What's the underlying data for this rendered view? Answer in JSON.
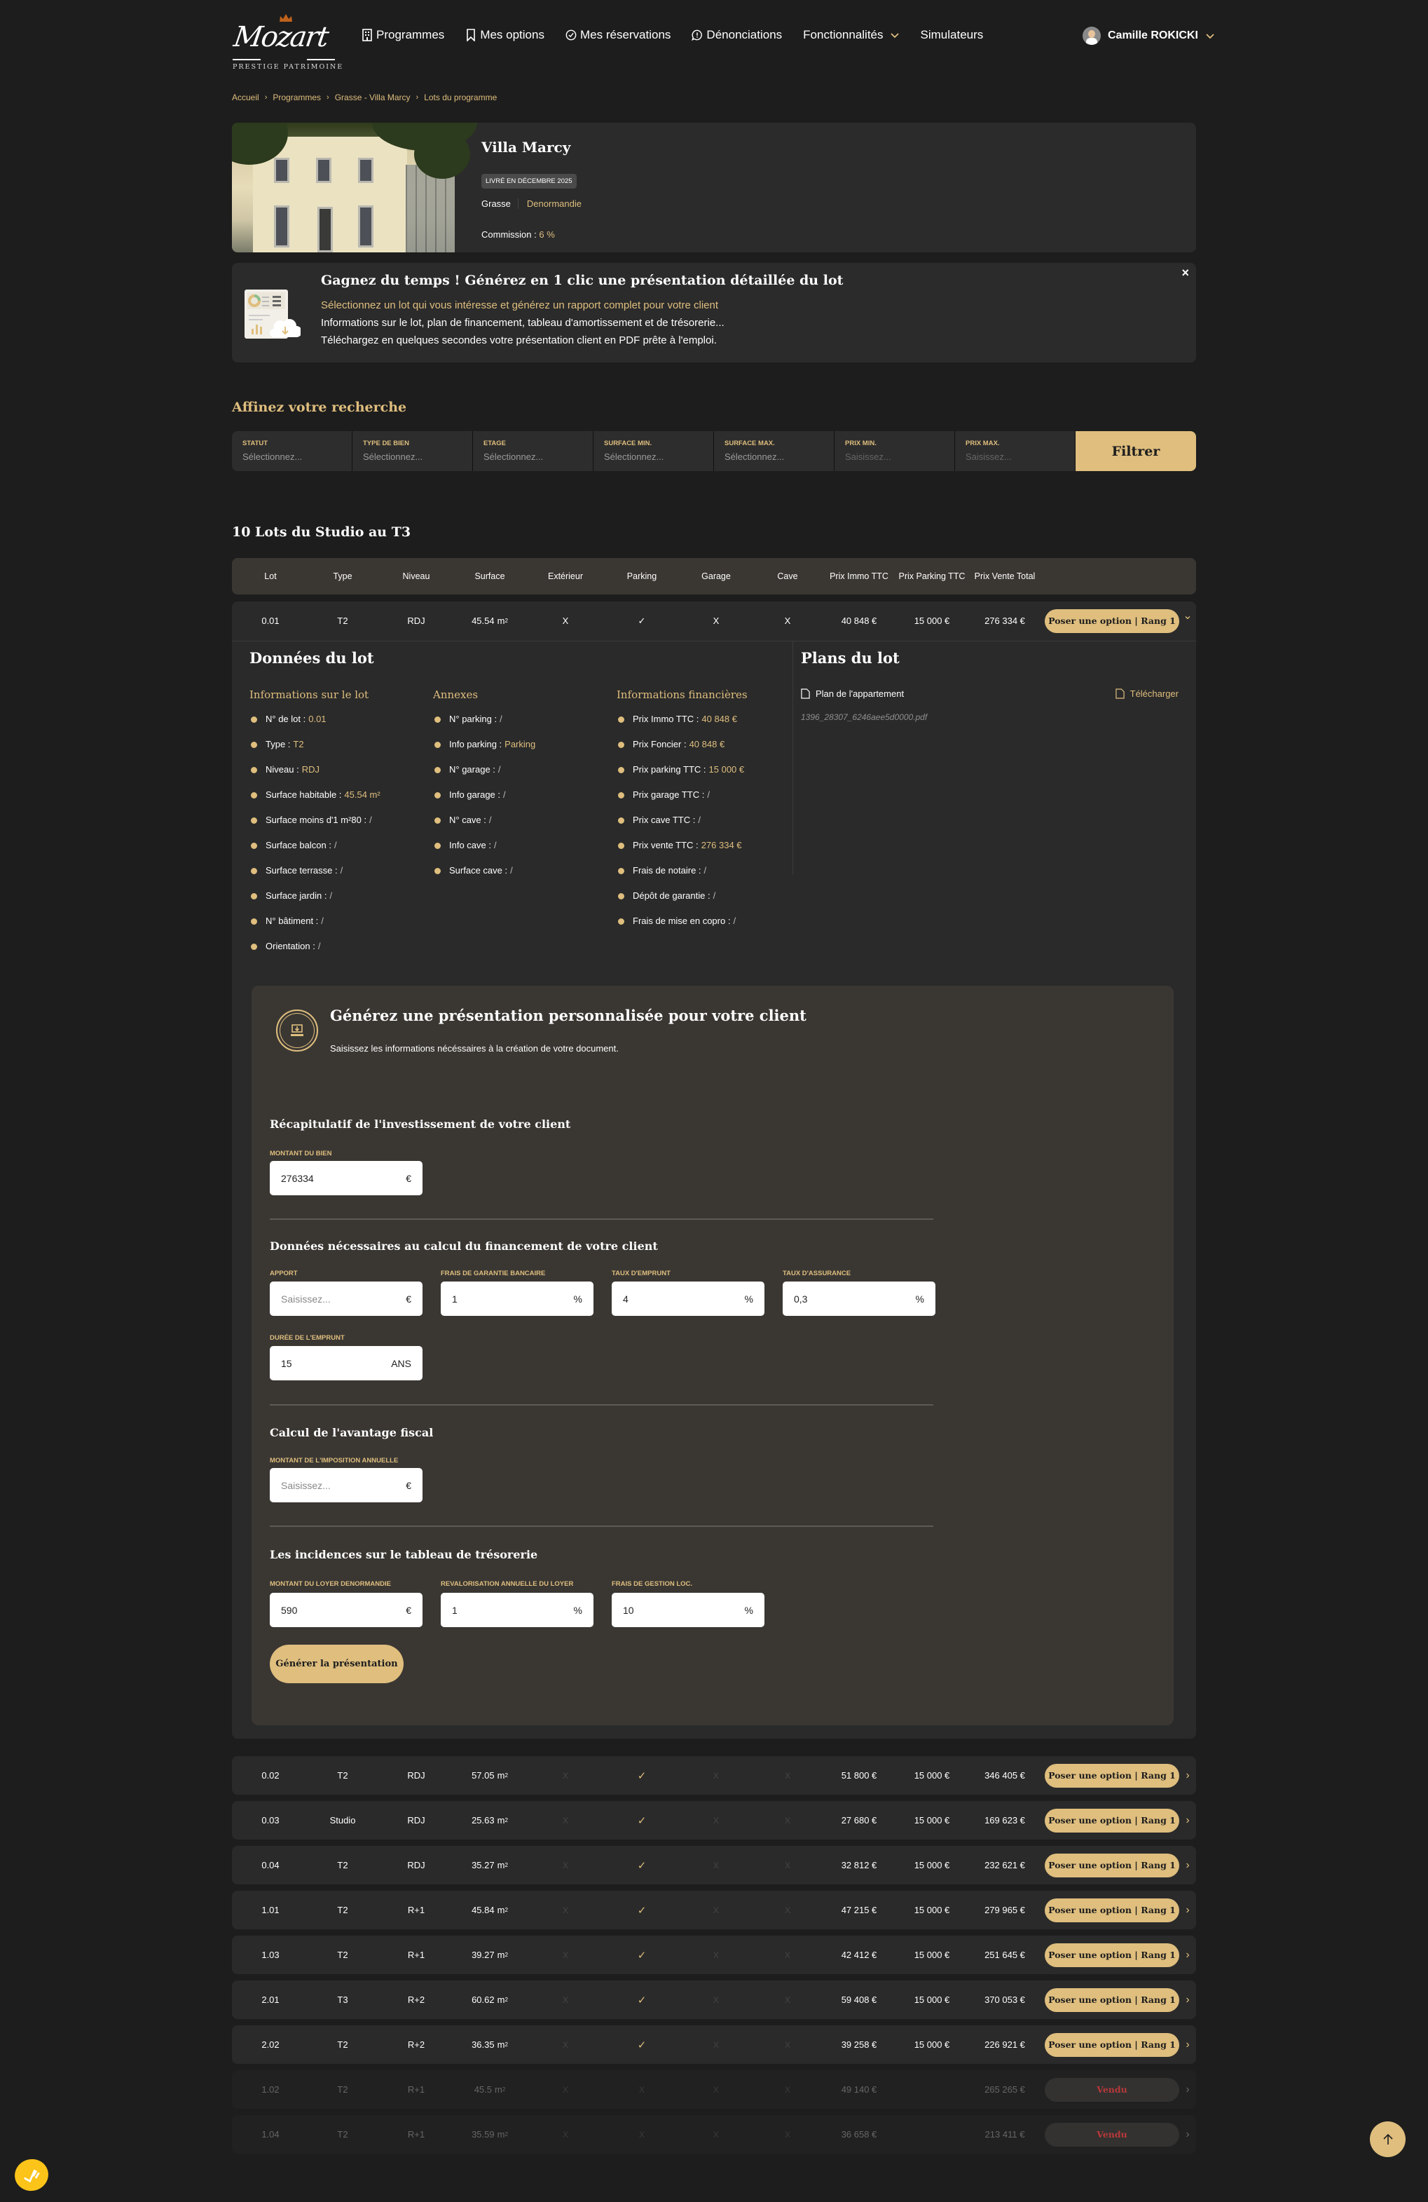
{
  "header": {
    "logo_text": "Mozart",
    "logo_tagline": "PRESTIGE PATRIMOINE",
    "nav": [
      {
        "label": "Programmes",
        "icon": "building-icon"
      },
      {
        "label": "Mes options",
        "icon": "bookmark-icon"
      },
      {
        "label": "Mes réservations",
        "icon": "check-circle-icon"
      },
      {
        "label": "Dénonciations",
        "icon": "message-alert-icon"
      },
      {
        "label": "Fonctionnalités",
        "icon": "chevron-down-icon"
      },
      {
        "label": "Simulateurs",
        "icon": ""
      }
    ],
    "user_name": "Camille ROKICKI"
  },
  "breadcrumb": [
    "Accueil",
    "Programmes",
    "Grasse - Villa Marcy",
    "Lots du programme"
  ],
  "program": {
    "title": "Villa Marcy",
    "delivery_badge": "LIVRÉ EN DÉCEMBRE 2025",
    "city": "Grasse",
    "law": "Denormandie",
    "commission_label": "Commission :",
    "commission_value": "6 %"
  },
  "promo": {
    "title": "Gagnez du temps ! Générez en 1 clic une présentation détaillée du lot",
    "line1": "Sélectionnez un lot qui vous intéresse et générez un rapport complet pour votre client",
    "line2": "Informations sur le lot, plan de financement, tableau d'amortissement et de trésorerie...",
    "line3": "Téléchargez en quelques secondes votre présentation client en PDF prête à l'emploi.",
    "close": "×"
  },
  "filters": {
    "title": "Affinez votre recherche",
    "fields": [
      {
        "label": "STATUT",
        "value": "Sélectionnez..."
      },
      {
        "label": "TYPE DE BIEN",
        "value": "Sélectionnez..."
      },
      {
        "label": "ETAGE",
        "value": "Sélectionnez..."
      },
      {
        "label": "SURFACE MIN.",
        "value": "Sélectionnez..."
      },
      {
        "label": "SURFACE MAX.",
        "value": "Sélectionnez..."
      },
      {
        "label": "PRIX MIN.",
        "placeholder": "Saisissez..."
      },
      {
        "label": "PRIX MAX.",
        "placeholder": "Saisissez..."
      }
    ],
    "button": "Filtrer"
  },
  "lots": {
    "title": "10 Lots du Studio au T3",
    "columns": [
      "Lot",
      "Type",
      "Niveau",
      "Surface",
      "Extérieur",
      "Parking",
      "Garage",
      "Cave",
      "Prix Immo TTC",
      "Prix Parking TTC",
      "Prix Vente Total"
    ],
    "option_label": "Poser une option | Rang 1",
    "sold_label": "Vendu",
    "no": "X",
    "yes": "✓",
    "surface_unit": "m",
    "rows": [
      {
        "lot": "0.01",
        "type": "T2",
        "niveau": "RDJ",
        "surface": "45.54",
        "ext": false,
        "parking": true,
        "garage": false,
        "cave": false,
        "immo": "40 848 €",
        "pparking": "15 000 €",
        "total": "276 334 €",
        "status": "available",
        "expanded": true
      },
      {
        "lot": "0.02",
        "type": "T2",
        "niveau": "RDJ",
        "surface": "57.05",
        "ext": false,
        "parking": true,
        "garage": false,
        "cave": false,
        "immo": "51 800 €",
        "pparking": "15 000 €",
        "total": "346 405 €",
        "status": "available"
      },
      {
        "lot": "0.03",
        "type": "Studio",
        "niveau": "RDJ",
        "surface": "25.63",
        "ext": false,
        "parking": true,
        "garage": false,
        "cave": false,
        "immo": "27 680 €",
        "pparking": "15 000 €",
        "total": "169 623 €",
        "status": "available"
      },
      {
        "lot": "0.04",
        "type": "T2",
        "niveau": "RDJ",
        "surface": "35.27",
        "ext": false,
        "parking": true,
        "garage": false,
        "cave": false,
        "immo": "32 812 €",
        "pparking": "15 000 €",
        "total": "232 621 €",
        "status": "available"
      },
      {
        "lot": "1.01",
        "type": "T2",
        "niveau": "R+1",
        "surface": "45.84",
        "ext": false,
        "parking": true,
        "garage": false,
        "cave": false,
        "immo": "47 215 €",
        "pparking": "15 000 €",
        "total": "279 965 €",
        "status": "available"
      },
      {
        "lot": "1.03",
        "type": "T2",
        "niveau": "R+1",
        "surface": "39.27",
        "ext": false,
        "parking": true,
        "garage": false,
        "cave": false,
        "immo": "42 412 €",
        "pparking": "15 000 €",
        "total": "251 645 €",
        "status": "available"
      },
      {
        "lot": "2.01",
        "type": "T3",
        "niveau": "R+2",
        "surface": "60.62",
        "ext": false,
        "parking": true,
        "garage": false,
        "cave": false,
        "immo": "59 408 €",
        "pparking": "15 000 €",
        "total": "370 053 €",
        "status": "available"
      },
      {
        "lot": "2.02",
        "type": "T2",
        "niveau": "R+2",
        "surface": "36.35",
        "ext": false,
        "parking": true,
        "garage": false,
        "cave": false,
        "immo": "39 258 €",
        "pparking": "15 000 €",
        "total": "226 921 €",
        "status": "available"
      },
      {
        "lot": "1.02",
        "type": "T2",
        "niveau": "R+1",
        "surface": "45.5",
        "ext": false,
        "parking": false,
        "garage": false,
        "cave": false,
        "immo": "49 140 €",
        "pparking": "",
        "total": "265 265 €",
        "status": "sold"
      },
      {
        "lot": "1.04",
        "type": "T2",
        "niveau": "R+1",
        "surface": "35.59",
        "ext": false,
        "parking": false,
        "garage": false,
        "cave": false,
        "immo": "36 658 €",
        "pparking": "",
        "total": "213 411 €",
        "status": "sold"
      }
    ]
  },
  "lot_details": {
    "title": "Données du lot",
    "columns": [
      {
        "title": "Informations sur le lot",
        "items": [
          {
            "label": "N° de lot :",
            "value": "0.01"
          },
          {
            "label": "Type :",
            "value": "T2"
          },
          {
            "label": "Niveau :",
            "value": "RDJ"
          },
          {
            "label": "Surface habitable :",
            "value": "45.54 m²"
          },
          {
            "label": "Surface moins d'1 m²80 :",
            "value": "/"
          },
          {
            "label": "Surface balcon :",
            "value": "/"
          },
          {
            "label": "Surface terrasse :",
            "value": "/"
          },
          {
            "label": "Surface jardin :",
            "value": "/"
          },
          {
            "label": "N° bâtiment :",
            "value": "/"
          },
          {
            "label": "Orientation :",
            "value": "/"
          }
        ]
      },
      {
        "title": "Annexes",
        "items": [
          {
            "label": "N° parking :",
            "value": "/"
          },
          {
            "label": "Info parking :",
            "value": "Parking"
          },
          {
            "label": "N° garage :",
            "value": "/"
          },
          {
            "label": "Info garage :",
            "value": "/"
          },
          {
            "label": "N° cave :",
            "value": "/"
          },
          {
            "label": "Info cave :",
            "value": "/"
          },
          {
            "label": "Surface cave :",
            "value": "/"
          }
        ]
      },
      {
        "title": "Informations financières",
        "items": [
          {
            "label": "Prix Immo TTC :",
            "value": "40 848 €"
          },
          {
            "label": "Prix Foncier :",
            "value": "40 848 €"
          },
          {
            "label": "Prix parking TTC :",
            "value": "15 000 €"
          },
          {
            "label": "Prix garage TTC :",
            "value": "/"
          },
          {
            "label": "Prix cave TTC :",
            "value": "/"
          },
          {
            "label": "Prix vente TTC :",
            "value": "276 334 €"
          },
          {
            "label": "Frais de notaire :",
            "value": "/"
          },
          {
            "label": "Dépôt de garantie :",
            "value": "/"
          },
          {
            "label": "Frais de mise en copro :",
            "value": "/"
          }
        ]
      }
    ],
    "plans": {
      "title": "Plans du lot",
      "item_label": "Plan de l'appartement",
      "download_label": "Télécharger",
      "file_name": "1396_28307_6246aee5d0000.pdf"
    }
  },
  "generator": {
    "title": "Générez une présentation personnalisée pour votre client",
    "subtitle": "Saisissez les informations nécéssaires à la création de votre document.",
    "sections": {
      "recap": "Récapitulatif de l'investissement de votre client",
      "financing": "Données nécessaires au calcul du financement de votre client",
      "tax": "Calcul de l'avantage fiscal",
      "treasury": "Les incidences sur le tableau de trésorerie"
    },
    "fields": {
      "montant_bien": {
        "label": "MONTANT DU BIEN",
        "value": "276334",
        "unit": "€"
      },
      "apport": {
        "label": "APPORT",
        "value": "",
        "placeholder": "Saisissez...",
        "unit": "€"
      },
      "frais_garantie": {
        "label": "FRAIS DE GARANTIE BANCAIRE",
        "value": "1",
        "unit": "%"
      },
      "taux_emprunt": {
        "label": "TAUX D'EMPRUNT",
        "value": "4",
        "unit": "%"
      },
      "taux_assurance": {
        "label": "TAUX D'ASSURANCE",
        "value": "0,3",
        "unit": "%"
      },
      "duree_emprunt": {
        "label": "DURÉE DE L'EMPRUNT",
        "value": "15",
        "unit": "ANS"
      },
      "imposition": {
        "label": "MONTANT DE L'IMPOSITION ANNUELLE",
        "value": "",
        "placeholder": "Saisissez...",
        "unit": "€"
      },
      "loyer": {
        "label": "MONTANT DU LOYER DENORMANDIE",
        "value": "590",
        "unit": "€"
      },
      "revalorisation": {
        "label": "REVALORISATION ANNUELLE DU LOYER",
        "value": "1",
        "unit": "%"
      },
      "frais_gestion": {
        "label": "FRAIS DE GESTION LOC.",
        "value": "10",
        "unit": "%"
      }
    },
    "button": "Générer la présentation"
  },
  "colors": {
    "accent": "#dfbe7e",
    "background": "#1d1d1d",
    "card": "#2a2a2a",
    "panel": "#3a3733",
    "sold": "#b8383a",
    "widget": "#fcc419"
  }
}
